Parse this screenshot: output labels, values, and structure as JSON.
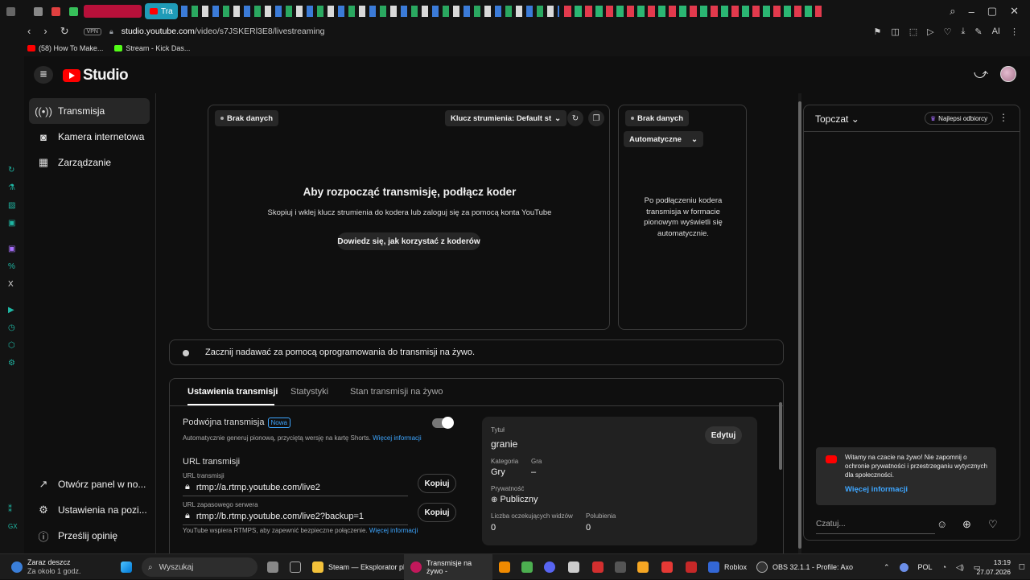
{
  "browser": {
    "active_tab": "Tra",
    "vpn": "VPN",
    "url_host": "studio.youtube.com",
    "url_path": "/video/s7JSKERl3E8/livestreaming",
    "ai_label": "AI",
    "bookmarks": [
      {
        "label": "(58) How To Make..."
      },
      {
        "label": "Stream - Kick Das..."
      }
    ]
  },
  "header": {
    "logo": "Studio"
  },
  "sidebar": {
    "items": [
      {
        "label": "Transmisja",
        "icon": "broadcast-icon"
      },
      {
        "label": "Kamera internetowa",
        "icon": "camera-icon"
      },
      {
        "label": "Zarządzanie",
        "icon": "calendar-icon"
      }
    ],
    "bottom": [
      {
        "label": "Otwórz panel w no...",
        "icon": "open-external-icon"
      },
      {
        "label": "Ustawienia na pozi...",
        "icon": "gear-icon"
      },
      {
        "label": "Prześlij opinię",
        "icon": "feedback-icon"
      }
    ]
  },
  "preview": {
    "no_data": "Brak danych",
    "stream_key": "Klucz strumienia: Default st",
    "heading": "Aby rozpocząć transmisję, podłącz koder",
    "sub": "Skopiuj i wklej klucz strumienia do kodera lub zaloguj się za pomocą konta YouTube",
    "learn_btn": "Dowiedz się, jak korzystać z koderów"
  },
  "vertical": {
    "no_data": "Brak danych",
    "auto": "Automatyczne",
    "text": "Po podłączeniu kodera transmisja w formacie pionowym wyświetli się automatycznie."
  },
  "status": {
    "text": "Zacznij nadawać za pomocą oprogramowania do transmisji na żywo."
  },
  "tabs": [
    "Ustawienia transmisji",
    "Statystyki",
    "Stan transmisji na żywo"
  ],
  "settings": {
    "dual_title": "Podwójna transmisja",
    "new_badge": "Nowa",
    "dual_desc": "Automatycznie generuj pionową, przyciętą wersję na kartę Shorts.",
    "more_info": "Więcej informacji",
    "url_heading": "URL transmisji",
    "url_label": "URL transmisji",
    "url_value": "rtmp://a.rtmp.youtube.com/live2",
    "backup_label": "URL zapasowego serwera",
    "backup_value": "rtmp://b.rtmp.youtube.com/live2?backup=1",
    "copy": "Kopiuj",
    "rtmps_note": "YouTube wspiera RTMPS, aby zapewnić bezpieczne połączenie."
  },
  "info": {
    "title_label": "Tytuł",
    "title": "granie",
    "edit": "Edytuj",
    "category_label": "Kategoria",
    "category": "Gry",
    "game_label": "Gra",
    "game": "–",
    "privacy_label": "Prywatność",
    "privacy": "Publiczny",
    "viewers_label": "Liczba oczekujących widzów",
    "viewers": "0",
    "likes_label": "Polubienia",
    "likes": "0"
  },
  "chat": {
    "mode": "Topczat",
    "top_fans": "Najlepsi odbiorcy",
    "welcome": "Witamy na czacie na żywo! Nie zapomnij o ochronie prywatności i przestrzeganiu wytycznych dla społeczności.",
    "more_info": "Więcej informacji",
    "placeholder": "Czatuj..."
  },
  "taskbar": {
    "weather_title": "Zaraz deszcz",
    "weather_sub": "Za około 1 godz.",
    "search": "Wyszukaj",
    "steam": "Steam — Eksplorator pl",
    "live": "Transmisje na żywo -",
    "roblox": "Roblox",
    "obs": "OBS 32.1.1 - Profile: Axo",
    "lang": "POL",
    "time": "13:19",
    "date": "27.07.2026"
  },
  "colors": {
    "accent": "#3ea6ff",
    "brand": "#ff0000",
    "bg": "#0f0f0f"
  }
}
